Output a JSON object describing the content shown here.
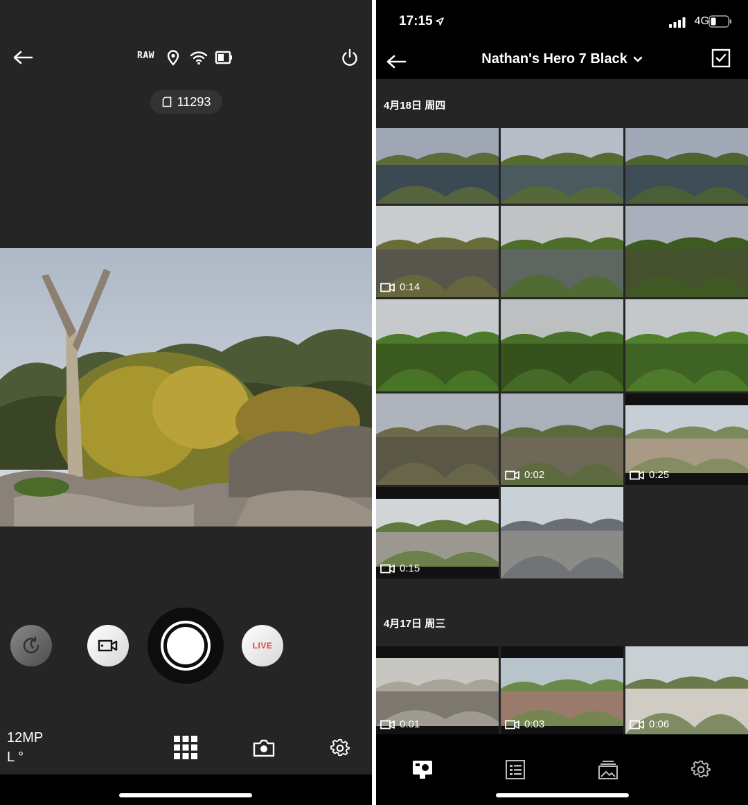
{
  "left": {
    "toolbar": {
      "back_icon": "arrow-left-icon",
      "raw": "RAW",
      "location_icon": "location-pin-icon",
      "wifi_icon": "wifi-icon",
      "battery_icon": "battery-icon",
      "power_icon": "power-icon"
    },
    "counter": {
      "icon": "sd-card-icon",
      "value": "11293"
    },
    "modes": {
      "timelapse_icon": "timelapse-icon",
      "video_icon": "video-camera-icon",
      "live": "LIVE"
    },
    "settings": {
      "resolution": "12MP",
      "lens": "L °"
    },
    "bottom": {
      "grid_icon": "grid-icon",
      "camera_icon": "camera-icon",
      "settings_icon": "gear-icon"
    }
  },
  "right": {
    "status": {
      "time": "17:15",
      "network": "4G"
    },
    "nav": {
      "back_icon": "arrow-left-icon",
      "title": "Nathan's Hero 7 Black",
      "select_icon": "checkbox-checked-icon"
    },
    "groups": [
      {
        "date": "4月18日 周四",
        "items": [
          {
            "kind": "photo",
            "duration": ""
          },
          {
            "kind": "photo",
            "duration": ""
          },
          {
            "kind": "photo",
            "duration": ""
          },
          {
            "kind": "video",
            "duration": "0:14"
          },
          {
            "kind": "photo",
            "duration": ""
          },
          {
            "kind": "photo",
            "duration": ""
          },
          {
            "kind": "photo",
            "duration": ""
          },
          {
            "kind": "photo",
            "duration": ""
          },
          {
            "kind": "photo",
            "duration": ""
          },
          {
            "kind": "photo",
            "duration": ""
          },
          {
            "kind": "video",
            "duration": "0:02"
          },
          {
            "kind": "video",
            "duration": "0:25"
          },
          {
            "kind": "video",
            "duration": "0:15"
          },
          {
            "kind": "photo",
            "duration": ""
          }
        ]
      },
      {
        "date": "4月17日 周三",
        "items": [
          {
            "kind": "video",
            "duration": "0:01"
          },
          {
            "kind": "video",
            "duration": "0:03"
          },
          {
            "kind": "video",
            "duration": "0:06"
          }
        ]
      }
    ],
    "tabbar": [
      "camera-tab-icon",
      "list-tab-icon",
      "media-tab-icon",
      "gear-icon"
    ]
  }
}
